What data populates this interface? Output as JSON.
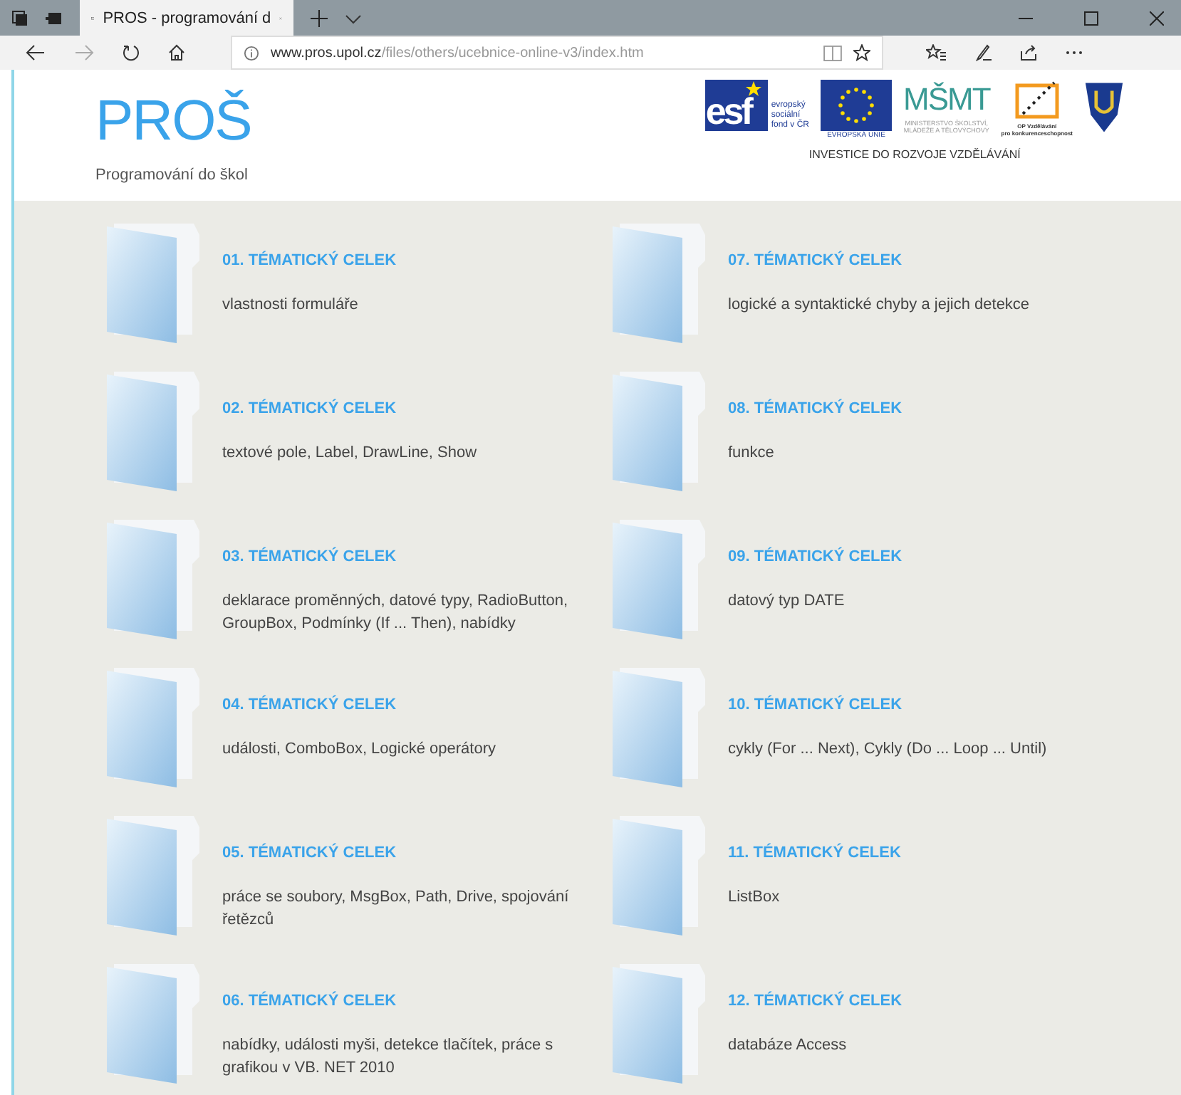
{
  "browser": {
    "tab_title": "PROS - programování d",
    "url_host": "www.pros.upol.cz",
    "url_path": "/files/others/ucebnice-online-v3/index.htm"
  },
  "header": {
    "logo": "PROŠ",
    "subtitle": "Programování do škol",
    "partners": [
      {
        "kind": "esf",
        "mark": "esf",
        "lines": [
          "evropský",
          "sociální",
          "fond v ČR"
        ]
      },
      {
        "kind": "eu",
        "lines": [
          "EVROPSKÁ UNIE"
        ]
      },
      {
        "kind": "msmt",
        "mark": "MŠMT",
        "lines": [
          "MINISTERSTVO ŠKOLSTVÍ,",
          "MLÁDEŽE A TĚLOVÝCHOVY"
        ]
      },
      {
        "kind": "op",
        "lines": [
          "OP Vzdělávání",
          "pro konkurenceschopnost"
        ]
      },
      {
        "kind": "upol"
      }
    ],
    "tagline": "INVESTICE DO ROZVOJE VZDĚLÁVÁNÍ"
  },
  "columns": [
    [
      {
        "title": "01. TÉMATICKÝ CELEK",
        "description": "vlastnosti formuláře"
      },
      {
        "title": "02. TÉMATICKÝ CELEK",
        "description": "textové pole, Label, DrawLine, Show"
      },
      {
        "title": "03. TÉMATICKÝ CELEK",
        "description": "deklarace proměnných, datové typy, RadioButton, GroupBox, Podmínky (If ... Then), nabídky"
      },
      {
        "title": "04. TÉMATICKÝ CELEK",
        "description": "události, ComboBox, Logické operátory"
      },
      {
        "title": "05. TÉMATICKÝ CELEK",
        "description": "práce se soubory, MsgBox, Path, Drive, spojování řetězců"
      },
      {
        "title": "06. TÉMATICKÝ CELEK",
        "description": "nabídky, události myši, detekce tlačítek, práce s grafikou v VB. NET 2010"
      }
    ],
    [
      {
        "title": "07. TÉMATICKÝ CELEK",
        "description": "logické a syntaktické chyby a jejich detekce"
      },
      {
        "title": "08. TÉMATICKÝ CELEK",
        "description": "funkce"
      },
      {
        "title": "09. TÉMATICKÝ CELEK",
        "description": "datový typ DATE"
      },
      {
        "title": "10. TÉMATICKÝ CELEK",
        "description": "cykly (For ... Next), Cykly (Do ... Loop ... Until)"
      },
      {
        "title": "11. TÉMATICKÝ CELEK",
        "description": "ListBox"
      },
      {
        "title": "12. TÉMATICKÝ CELEK",
        "description": "databáze Access"
      }
    ]
  ]
}
